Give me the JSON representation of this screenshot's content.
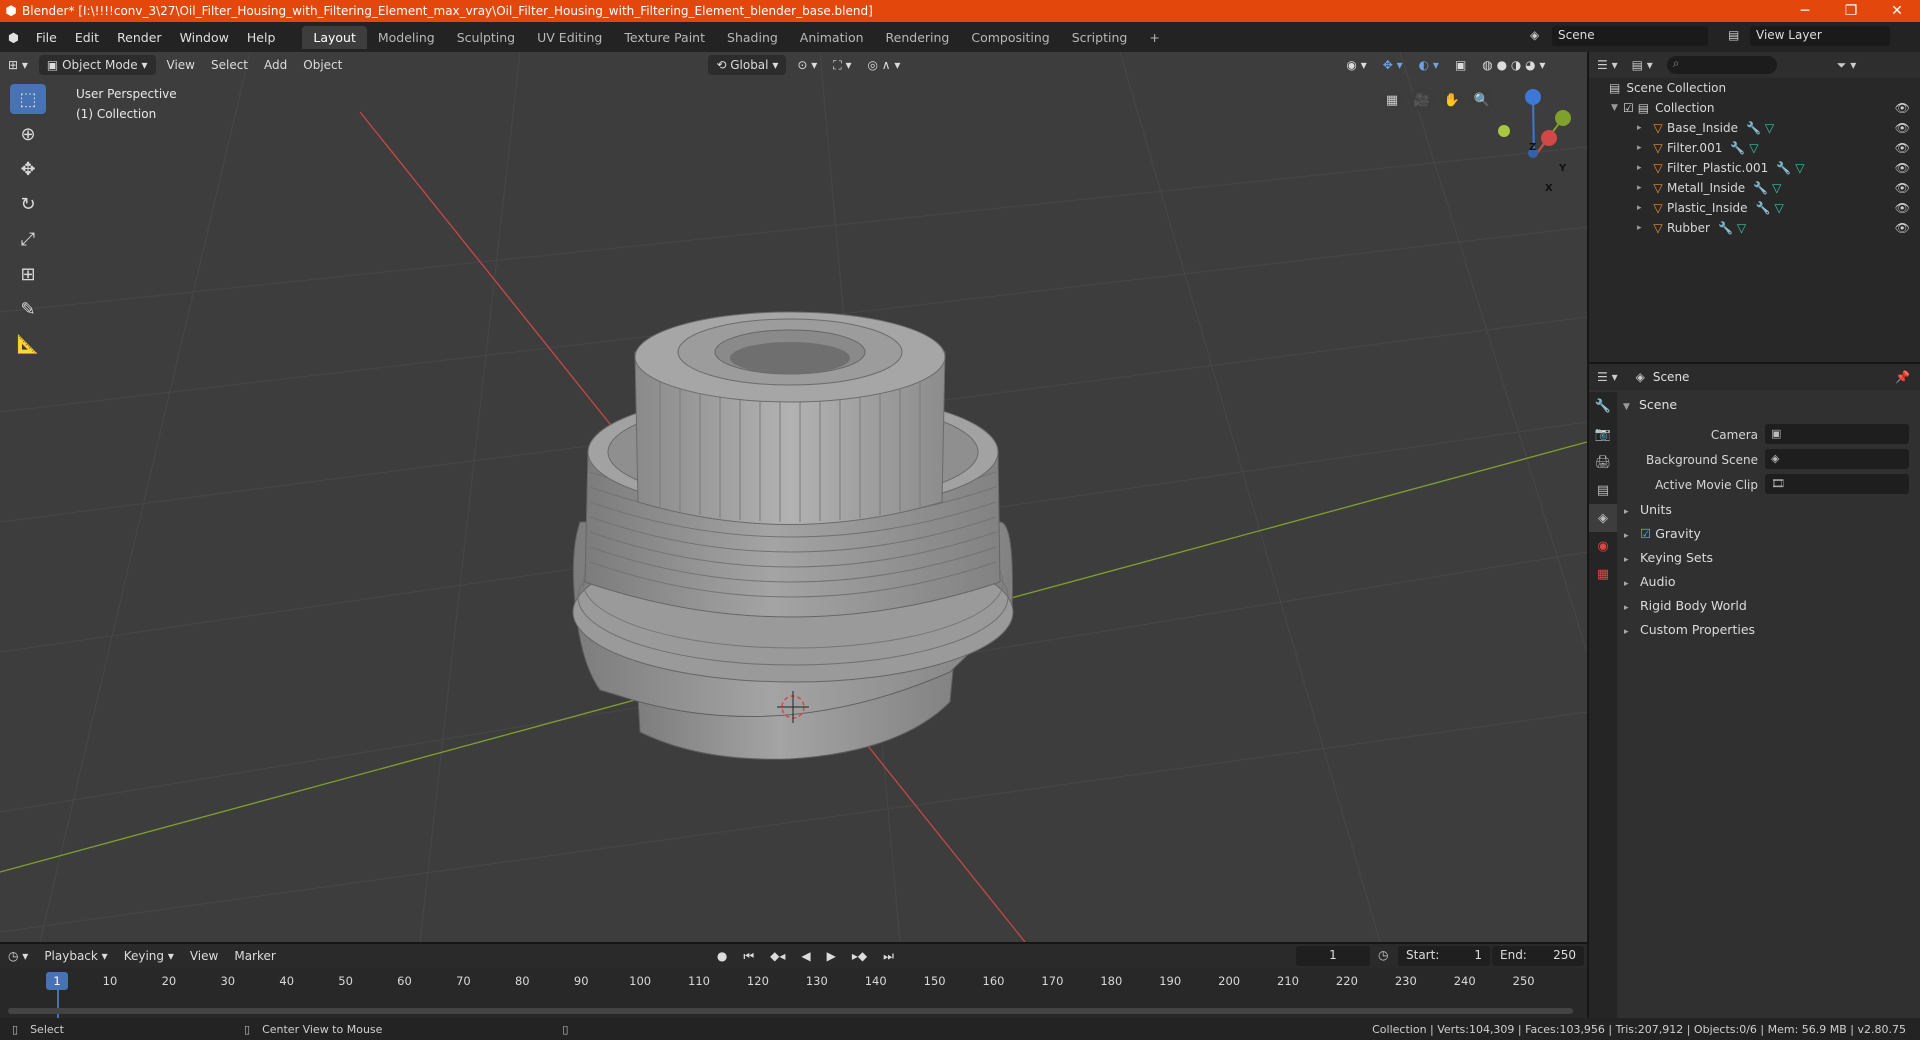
{
  "window": {
    "title": "Blender* [I:\\!!!!conv_3\\27\\Oil_Filter_Housing_with_Filtering_Element_max_vray\\Oil_Filter_Housing_with_Filtering_Element_blender_base.blend]",
    "minimize": "─",
    "maximize": "❐",
    "close": "✕"
  },
  "menu": [
    "File",
    "Edit",
    "Render",
    "Window",
    "Help"
  ],
  "workspaces": [
    "Layout",
    "Modeling",
    "Sculpting",
    "UV Editing",
    "Texture Paint",
    "Shading",
    "Animation",
    "Rendering",
    "Compositing",
    "Scripting"
  ],
  "workspace_add": "+",
  "scene_field": "Scene",
  "view_layer_field": "View Layer",
  "viewport": {
    "mode": "Object Mode",
    "menus": [
      "View",
      "Select",
      "Add",
      "Object"
    ],
    "transform_orientation": "Global",
    "perspective_label": "User Perspective",
    "collection_label": "(1) Collection",
    "gizmo": {
      "x": "X",
      "y": "Y",
      "z": "Z"
    }
  },
  "outliner": {
    "root": "Scene Collection",
    "collection": "Collection",
    "objects": [
      "Base_Inside",
      "Filter.001",
      "Filter_Plastic.001",
      "Metall_Inside",
      "Plastic_Inside",
      "Rubber"
    ]
  },
  "properties": {
    "header": "Scene",
    "panel": "Scene",
    "camera_label": "Camera",
    "background_scene_label": "Background Scene",
    "active_movie_clip_label": "Active Movie Clip",
    "sections": [
      "Units",
      "Gravity",
      "Keying Sets",
      "Audio",
      "Rigid Body World",
      "Custom Properties"
    ]
  },
  "timeline": {
    "menus": [
      "Playback",
      "Keying",
      "View",
      "Marker"
    ],
    "current_frame": "1",
    "start_label": "Start:",
    "start": "1",
    "end_label": "End:",
    "end": "250",
    "ticks": [
      "10",
      "20",
      "30",
      "40",
      "50",
      "60",
      "70",
      "80",
      "90",
      "100",
      "110",
      "120",
      "130",
      "140",
      "150",
      "160",
      "170",
      "180",
      "190",
      "200",
      "210",
      "220",
      "230",
      "240",
      "250"
    ],
    "playhead_label": "1"
  },
  "statusbar": {
    "select": "Select",
    "center_view": "Center View to Mouse",
    "stats": "Collection | Verts:104,309 | Faces:103,956 | Tris:207,912 | Objects:0/6 | Mem: 56.9 MB | v2.80.75"
  },
  "colors": {
    "titlebar": "#e3470b",
    "accent": "#4772b3",
    "viewport_bg": "#3d3d3d",
    "x_axis": "#d04848",
    "y_axis": "#7fa02c",
    "z_axis": "#3d78d6"
  }
}
